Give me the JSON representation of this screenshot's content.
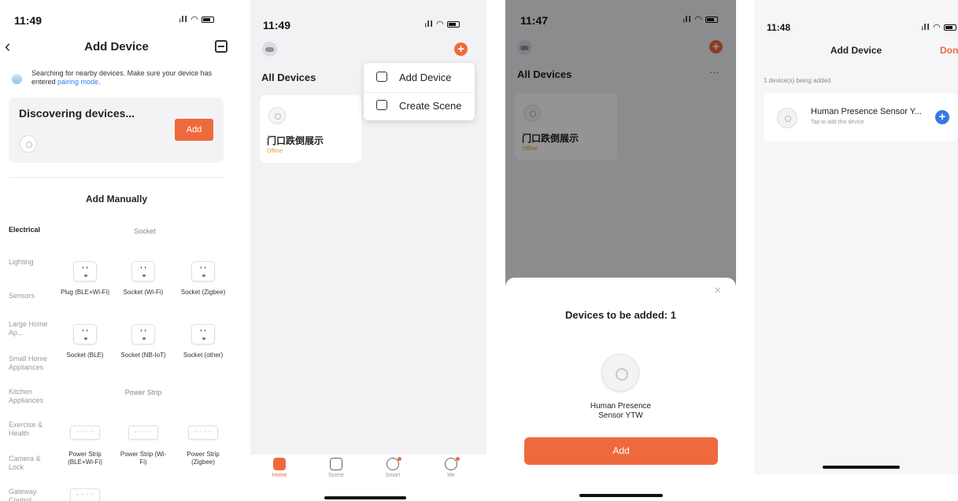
{
  "screens": {
    "add_device": {
      "time": "11:49",
      "title": "Add Device",
      "searching_text": "Searching for nearby devices. Make sure your device has entered ",
      "pairing_link": "pairing mode",
      "searching_suffix": ".",
      "discovering_title": "Discovering devices...",
      "add_button": "Add",
      "manual_title": "Add Manually",
      "categories": [
        "Electrical",
        "Lighting",
        "Sensors",
        "Large Home Ap...",
        "Small Home Appliances",
        "Kitchen Appliances",
        "Exercise & Health",
        "Camera & Lock",
        "Gateway Control"
      ],
      "group_socket": "Socket",
      "group_power_strip": "Power Strip",
      "devices": [
        "Plug (BLE+Wi-Fi)",
        "Socket (Wi-Fi)",
        "Socket (Zigbee)",
        "Socket (BLE)",
        "Socket (NB-IoT)",
        "Socket (other)",
        "Power Strip (BLE+Wi-Fi)",
        "Power Strip (Wi-Fi)",
        "Power Strip (Zigbee)"
      ]
    },
    "home": {
      "time": "11:49",
      "title": "All Devices",
      "menu_items": [
        "Add Device",
        "Create Scene"
      ],
      "device_name": "门口跌倒展示",
      "device_status": "Offline",
      "tabs": [
        "Home",
        "Scene",
        "Smart",
        "Me"
      ]
    },
    "confirm": {
      "time": "11:47",
      "title": "All Devices",
      "more": "···",
      "device_name": "门口跌倒展示",
      "device_status": "Offline",
      "close": "×",
      "sheet_title": "Devices to be added: 1",
      "sheet_device_name": "Human Presence Sensor YTW",
      "sheet_add": "Add"
    },
    "adding": {
      "time": "11:48",
      "title": "Add Device",
      "done": "Done",
      "subtitle": "1 device(s) being added",
      "device_name": "Human Presence Sensor Y...",
      "device_hint": "Tap to add this device"
    }
  },
  "colors": {
    "accent": "#ee6a3d",
    "link": "#2f80ed",
    "plus_blue": "#3578e5",
    "offline": "#e59a3c"
  },
  "icons": [
    "back-icon",
    "scan-icon",
    "bluetooth-search-icon",
    "plus-icon",
    "add-device-icon",
    "create-scene-icon",
    "close-icon",
    "home-icon",
    "scene-icon",
    "smart-icon",
    "me-icon"
  ]
}
